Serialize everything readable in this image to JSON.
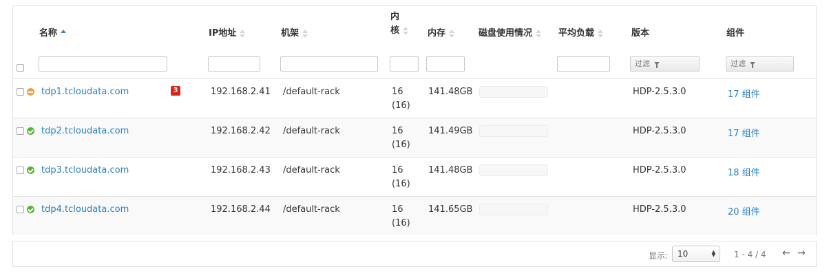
{
  "columns": {
    "name": "名称",
    "ip": "IP地址",
    "rack": "机架",
    "cores_line1": "内",
    "cores_line2": "核",
    "memory": "内存",
    "disk": "磁盘使用情况",
    "load": "平均负载",
    "version": "版本",
    "components": "组件"
  },
  "filters": {
    "version_filter_label": "过滤",
    "components_filter_label": "过滤"
  },
  "hosts": [
    {
      "name": "tdp1.tcloudata.com",
      "status": "warning",
      "alerts": "3",
      "ip": "192.168.2.41",
      "rack": "/default-rack",
      "cores": "16",
      "cores_total": "(16)",
      "memory": "141.48GB",
      "version": "HDP-2.5.3.0",
      "components": "17 组件"
    },
    {
      "name": "tdp2.tcloudata.com",
      "status": "healthy",
      "alerts": "",
      "ip": "192.168.2.42",
      "rack": "/default-rack",
      "cores": "16",
      "cores_total": "(16)",
      "memory": "141.49GB",
      "version": "HDP-2.5.3.0",
      "components": "17 组件"
    },
    {
      "name": "tdp3.tcloudata.com",
      "status": "healthy",
      "alerts": "",
      "ip": "192.168.2.43",
      "rack": "/default-rack",
      "cores": "16",
      "cores_total": "(16)",
      "memory": "141.48GB",
      "version": "HDP-2.5.3.0",
      "components": "18 组件"
    },
    {
      "name": "tdp4.tcloudata.com",
      "status": "healthy",
      "alerts": "",
      "ip": "192.168.2.44",
      "rack": "/default-rack",
      "cores": "16",
      "cores_total": "(16)",
      "memory": "141.65GB",
      "version": "HDP-2.5.3.0",
      "components": "20 组件"
    }
  ],
  "pagination": {
    "show_label": "显示:",
    "page_size": "10",
    "range": "1 - 4 / 4",
    "prev_icon": "←",
    "next_icon": "→"
  },
  "colors": {
    "link": "#2b80c3",
    "status_warning": "#f0a23c",
    "status_healthy": "#5cb532",
    "alert_badge": "#d9251c"
  }
}
